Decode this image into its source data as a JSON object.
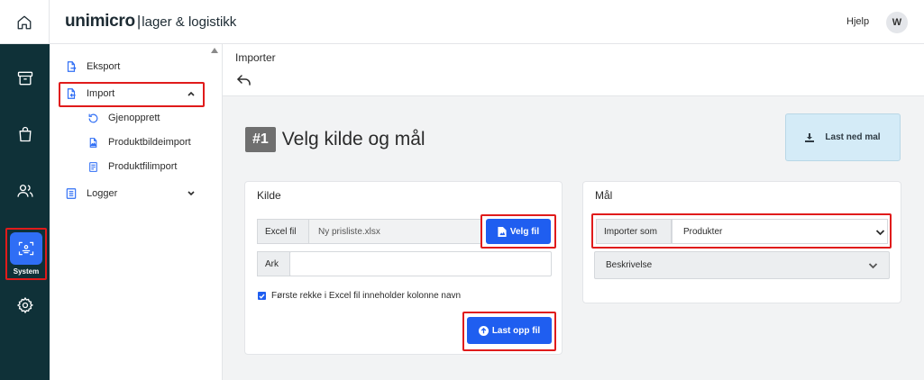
{
  "header": {
    "logo_main": "unimicro",
    "logo_sep": "|",
    "logo_sub": "lager & logistikk",
    "help_label": "Hjelp",
    "avatar_initial": "W"
  },
  "rail": {
    "items": [
      {
        "icon": "home-icon"
      },
      {
        "icon": "archive-box-icon"
      },
      {
        "icon": "shopping-bag-icon"
      },
      {
        "icon": "users-icon"
      },
      {
        "icon": "system-icon",
        "label": "System",
        "active": true
      },
      {
        "icon": "gear-icon"
      }
    ],
    "system_label": "System",
    "active_color": "#2f6ef5"
  },
  "sidenav": {
    "export_label": "Eksport",
    "import_label": "Import",
    "sub_items": [
      "Gjenopprett",
      "Produktbildeimport",
      "Produktfilimport"
    ],
    "logs_label": "Logger"
  },
  "page": {
    "title": "Importer",
    "step_number": "#1",
    "step_title": "Velg kilde og mål",
    "download_label": "Last ned mal"
  },
  "source": {
    "title": "Kilde",
    "excel_label": "Excel fil",
    "excel_value": "Ny prisliste.xlsx",
    "choose_file_label": "Velg fil",
    "sheet_label": "Ark",
    "sheet_value": "",
    "checkbox_label": "Første rekke i Excel fil inneholder kolonne navn",
    "checkbox_checked": true,
    "upload_label": "Last opp fil"
  },
  "target": {
    "title": "Mål",
    "import_as_label": "Importer som",
    "import_as_value": "Produkter",
    "description_label": "Beskrivelse"
  },
  "colors": {
    "accent": "#1f5ef0",
    "rail_bg": "#0f3138",
    "highlight": "#e01b1b",
    "download_bg": "#d4ebf7"
  }
}
